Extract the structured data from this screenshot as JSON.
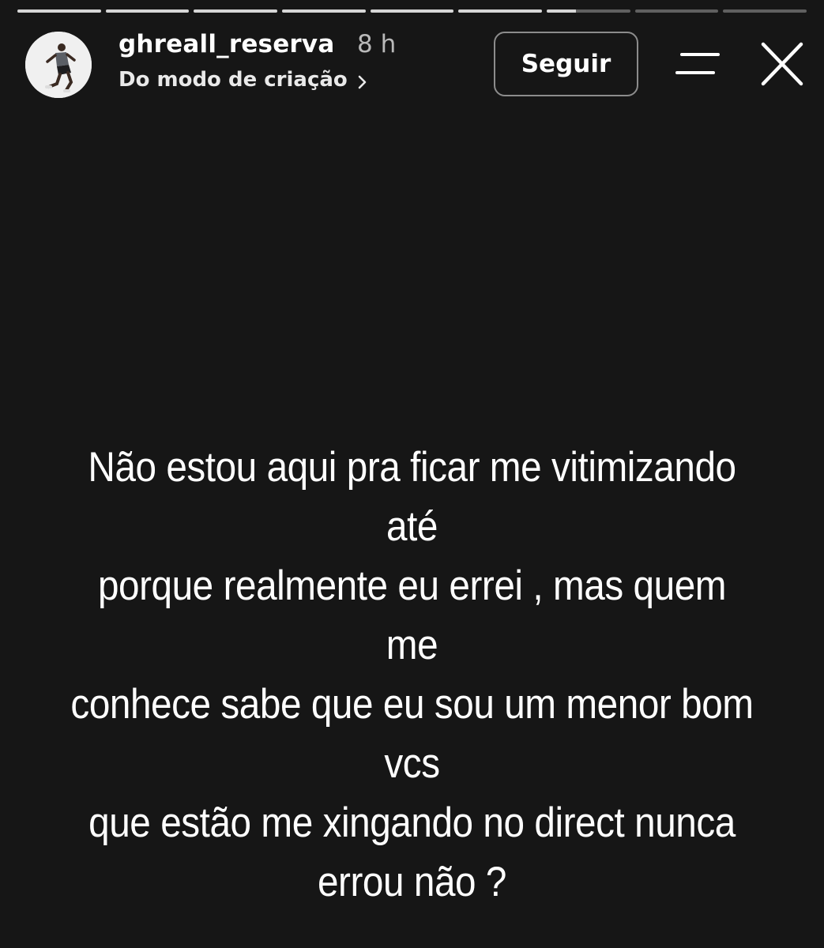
{
  "story": {
    "progress_segments": [
      1,
      1,
      1,
      1,
      1,
      1,
      0.35,
      0,
      0
    ],
    "progress_color": "#d6d6d6"
  },
  "header": {
    "username": "ghreall_reserva",
    "time": "8 h",
    "subtitle": "Do modo de criação",
    "subtitle_chevron_icon": "chevron-right-icon",
    "follow_label": "Seguir",
    "menu_icon": "menu-icon",
    "close_icon": "close-icon"
  },
  "content": {
    "lines": [
      "Não estou aqui pra ficar me vitimizando até",
      "porque realmente eu errei , mas quem me",
      "conhece sabe que eu sou um menor bom vcs",
      "que estão me xingando no direct nunca",
      "errou não ?"
    ],
    "background": "#161616"
  }
}
